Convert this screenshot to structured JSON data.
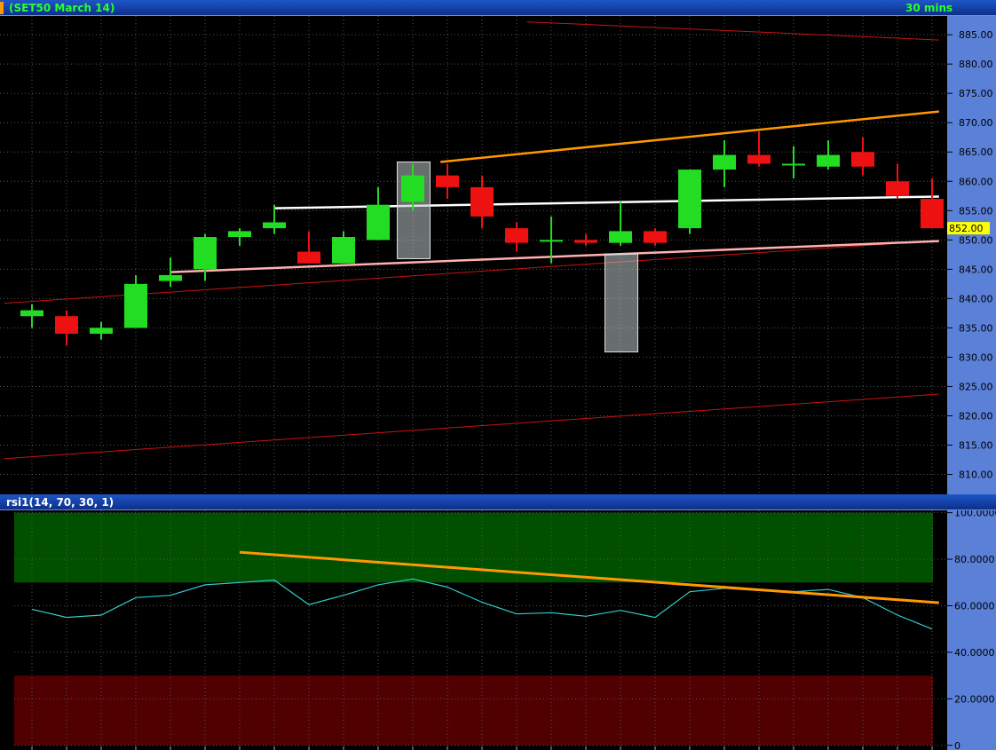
{
  "main_panel": {
    "title": "(SET50 March 14)",
    "interval": "30 mins"
  },
  "rsi_panel": {
    "title": "rsi1(14, 70, 30, 1)"
  },
  "colors": {
    "up": "#22dd22",
    "down": "#ee1111",
    "background": "#000000",
    "axis_panel": "#5a80d8",
    "grid": "#555555",
    "overbought_zone": "#005000",
    "oversold_zone": "#500000",
    "rsi_line": "#33cccc",
    "trendline_orange": "#ff9900",
    "trendline_red": "#cc1111",
    "trendline_white": "#ffffff",
    "trendline_pink": "#ffb0b0",
    "last_price_tag": "#ffff00"
  },
  "chart_data": [
    {
      "type": "candlestick",
      "title": "(SET50 March 14)",
      "interval": "30 mins",
      "y_ticks": [
        885,
        880,
        875,
        870,
        865,
        860,
        855,
        850,
        845,
        840,
        835,
        830,
        825,
        820,
        815,
        810
      ],
      "y_tick_labels": [
        "885.00",
        "880.00",
        "875.00",
        "870.00",
        "865.00",
        "860.00",
        "855.00",
        "850.00",
        "845.00",
        "840.00",
        "835.00",
        "830.00",
        "825.00",
        "820.00",
        "815.00",
        "810.00"
      ],
      "ylim": [
        806.6,
        888.2
      ],
      "last_price_label": "852.00",
      "last_price": 852.0,
      "candles": [
        {
          "open": 837.0,
          "high": 839.0,
          "low": 835.0,
          "close": 838.0
        },
        {
          "open": 837.0,
          "high": 838.0,
          "low": 832.0,
          "close": 834.0
        },
        {
          "open": 834.0,
          "high": 836.0,
          "low": 833.0,
          "close": 835.0
        },
        {
          "open": 835.0,
          "high": 844.0,
          "low": 835.0,
          "close": 842.5
        },
        {
          "open": 843.0,
          "high": 847.0,
          "low": 842.0,
          "close": 844.0
        },
        {
          "open": 845.0,
          "high": 851.0,
          "low": 843.0,
          "close": 850.5
        },
        {
          "open": 850.5,
          "high": 852.0,
          "low": 849.0,
          "close": 851.5
        },
        {
          "open": 852.0,
          "high": 856.0,
          "low": 851.0,
          "close": 853.0
        },
        {
          "open": 848.0,
          "high": 851.5,
          "low": 846.0,
          "close": 846.0
        },
        {
          "open": 846.0,
          "high": 851.5,
          "low": 846.0,
          "close": 850.5
        },
        {
          "open": 850.0,
          "high": 859.0,
          "low": 850.0,
          "close": 856.0
        },
        {
          "open": 856.5,
          "high": 863.0,
          "low": 855.0,
          "close": 861.0
        },
        {
          "open": 861.0,
          "high": 863.0,
          "low": 857.0,
          "close": 859.0
        },
        {
          "open": 859.0,
          "high": 861.0,
          "low": 852.0,
          "close": 854.0
        },
        {
          "open": 852.0,
          "high": 853.0,
          "low": 848.0,
          "close": 849.5
        },
        {
          "open": 850.0,
          "high": 854.0,
          "low": 846.0,
          "close": 850.0
        },
        {
          "open": 850.0,
          "high": 851.0,
          "low": 849.0,
          "close": 849.5
        },
        {
          "open": 849.5,
          "high": 856.5,
          "low": 849.0,
          "close": 851.5
        },
        {
          "open": 851.5,
          "high": 852.0,
          "low": 849.0,
          "close": 849.5
        },
        {
          "open": 852.0,
          "high": 862.0,
          "low": 851.0,
          "close": 862.0
        },
        {
          "open": 862.0,
          "high": 867.0,
          "low": 859.0,
          "close": 864.5
        },
        {
          "open": 864.5,
          "high": 868.5,
          "low": 862.5,
          "close": 863.0
        },
        {
          "open": 863.0,
          "high": 866.0,
          "low": 860.5,
          "close": 863.0
        },
        {
          "open": 862.5,
          "high": 867.0,
          "low": 862.0,
          "close": 864.5
        },
        {
          "open": 865.0,
          "high": 867.5,
          "low": 861.0,
          "close": 862.5
        },
        {
          "open": 860.0,
          "high": 863.0,
          "low": 857.0,
          "close": 857.5
        },
        {
          "open": 857.0,
          "high": 860.5,
          "low": 852.0,
          "close": 852.0
        }
      ],
      "trendlines": [
        {
          "color": "#cc1111",
          "from": [
            -0.8,
            812.7
          ],
          "to": [
            26.2,
            823.7
          ]
        },
        {
          "color": "#cc1111",
          "from": [
            -0.8,
            839.2
          ],
          "to": [
            26.2,
            849.9
          ]
        },
        {
          "color": "#cc1111",
          "from": [
            14.3,
            887.2
          ],
          "to": [
            26.2,
            884.1
          ]
        },
        {
          "color": "#ff9900",
          "from": [
            11.8,
            863.3
          ],
          "to": [
            26.2,
            871.9
          ]
        },
        {
          "color": "#ffffff",
          "from": [
            7.0,
            855.4
          ],
          "to": [
            26.2,
            857.4
          ]
        },
        {
          "color": "#ffb0b0",
          "from": [
            4.0,
            844.5
          ],
          "to": [
            26.2,
            849.8
          ]
        }
      ],
      "gray_boxes": [
        {
          "x0": 10.55,
          "x1": 11.5,
          "y_low": 846.8,
          "y_high": 863.3
        },
        {
          "x0": 16.55,
          "x1": 17.5,
          "y_low": 830.9,
          "y_high": 847.6
        }
      ]
    },
    {
      "type": "line",
      "title": "rsi1(14, 70, 30, 1)",
      "y_ticks": [
        100,
        80,
        60,
        40,
        20,
        0
      ],
      "y_tick_labels": [
        "100.0000",
        "80.0000",
        "60.0000",
        "40.0000",
        "20.0000",
        "0"
      ],
      "ylim": [
        -2.0,
        101.0
      ],
      "zones": [
        {
          "name": "overbought",
          "from": 70,
          "to": 100,
          "color": "#005000"
        },
        {
          "name": "oversold",
          "from": 0,
          "to": 30,
          "color": "#500000"
        }
      ],
      "series": [
        {
          "color": "#33cccc",
          "values": [
            58.5,
            55.0,
            56.0,
            63.5,
            64.5,
            69.0,
            70.0,
            71.0,
            60.5,
            64.5,
            69.0,
            71.5,
            68.0,
            61.5,
            56.5,
            57.0,
            55.5,
            58.0,
            55.0,
            66.0,
            67.5,
            66.5,
            66.0,
            67.0,
            63.5,
            56.0,
            50.0
          ]
        }
      ],
      "trendline": {
        "color": "#ff9900",
        "from": [
          6.0,
          83.0
        ],
        "to": [
          26.2,
          61.3
        ]
      }
    }
  ]
}
